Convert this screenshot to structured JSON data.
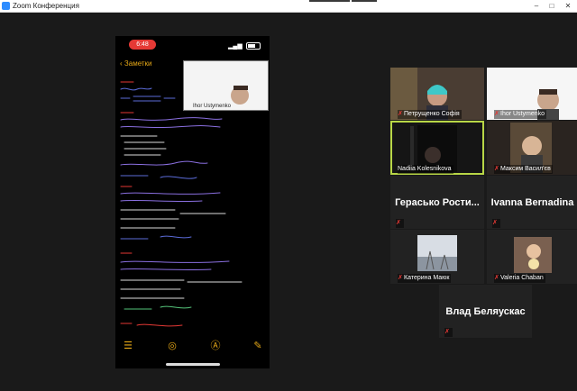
{
  "window": {
    "title": "Zoom Конференция",
    "minimize": "–",
    "maximize": "□",
    "close": "✕"
  },
  "colors": {
    "accent": "#e6a817",
    "active_speaker": "#b8d646",
    "muted": "#e53935",
    "tile_bg": "#222222"
  },
  "phone": {
    "time": "6:48",
    "back_label": "Заметки",
    "toolbar_icons": [
      "checklist-icon",
      "camera-icon",
      "markup-icon",
      "compose-icon"
    ]
  },
  "pip": {
    "name": "Ihor Ustymenko"
  },
  "participants": [
    {
      "name": "Петрущенко Софія",
      "video": true,
      "muted": true
    },
    {
      "name": "Ihor Ustymenko",
      "video": true,
      "muted": true
    },
    {
      "name": "Nadiia Kolesnikova",
      "video": true,
      "muted": false,
      "active": true
    },
    {
      "name": "Максим Васил'єв",
      "video": true,
      "muted": true
    },
    {
      "name": "Герасько Рости...",
      "video": false,
      "muted": true
    },
    {
      "name": "Ivanna Bernadina",
      "video": false,
      "muted": true
    },
    {
      "name": "Катерина Маюк",
      "video": true,
      "muted": true
    },
    {
      "name": "Valeria Chaban",
      "video": true,
      "muted": true
    },
    {
      "name": "Влад Беляускас",
      "video": false,
      "muted": true
    }
  ]
}
